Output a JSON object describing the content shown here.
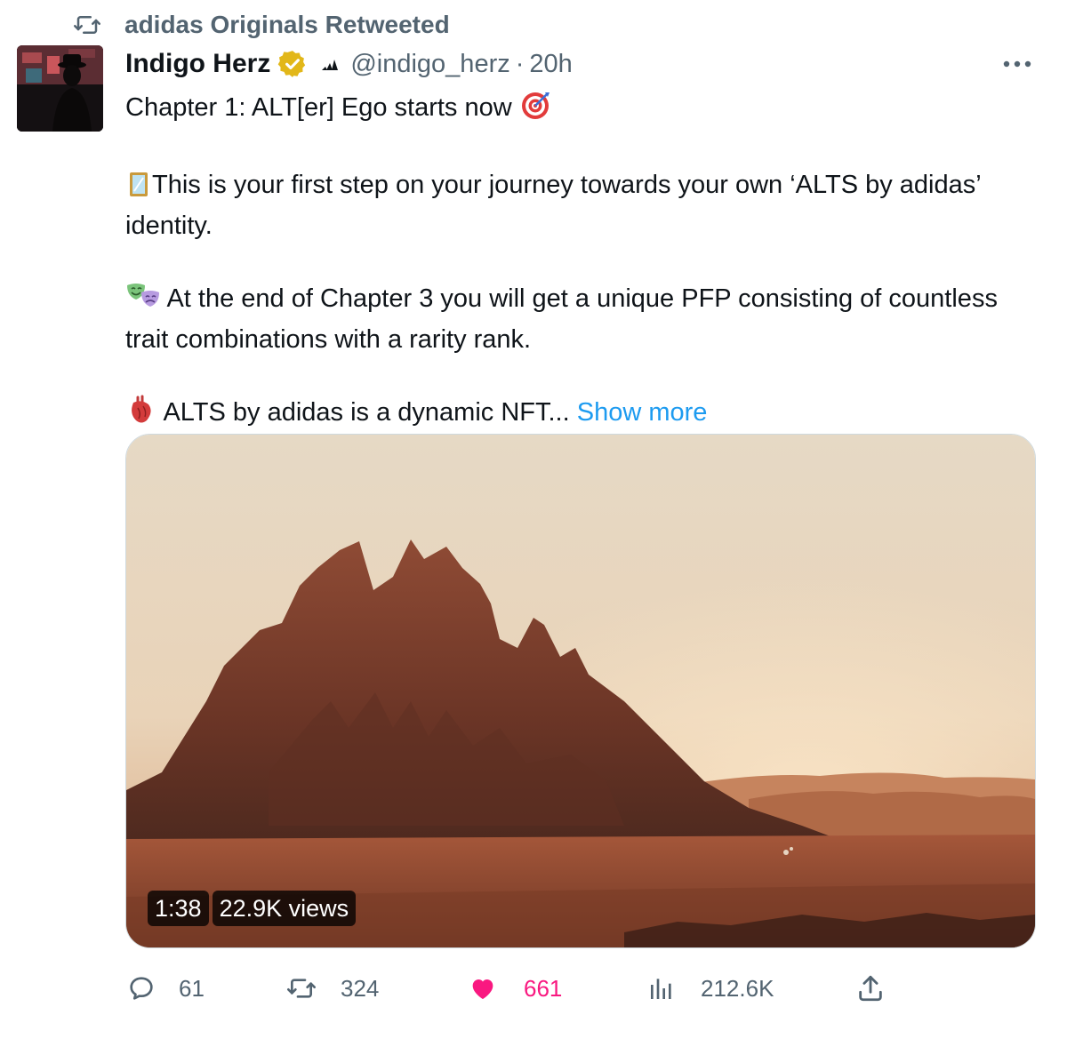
{
  "retweet": {
    "label": "adidas Originals Retweeted"
  },
  "author": {
    "name": "Indigo Herz",
    "handle": "@indigo_herz",
    "separator": "·",
    "time": "20h"
  },
  "tweet": {
    "line1": "Chapter 1: ALT[er] Ego starts now",
    "para2": "This is your first step on your journey towards your own ‘ALTS by adidas’ identity.",
    "para3": "At the end of Chapter 3 you will get a unique PFP consisting of countless trait combinations with a rarity rank.",
    "para4": "ALTS by adidas is a dynamic NFT...",
    "show_more": "Show more"
  },
  "media": {
    "duration": "1:38",
    "views": "22.9K views"
  },
  "actions": {
    "replies": "61",
    "retweets": "324",
    "likes": "661",
    "views": "212.6K"
  },
  "colors": {
    "text": "#0f1419",
    "secondary": "#536471",
    "link": "#1d9bf0",
    "like": "#f91880",
    "verified": "#e2b719"
  },
  "icons": [
    "retweet-icon",
    "verified-badge-icon",
    "adidas-logo-icon",
    "more-icon",
    "target-emoji",
    "mirror-emoji",
    "masks-emoji",
    "heart-organ-emoji",
    "reply-icon",
    "heart-icon",
    "views-icon",
    "share-icon"
  ]
}
